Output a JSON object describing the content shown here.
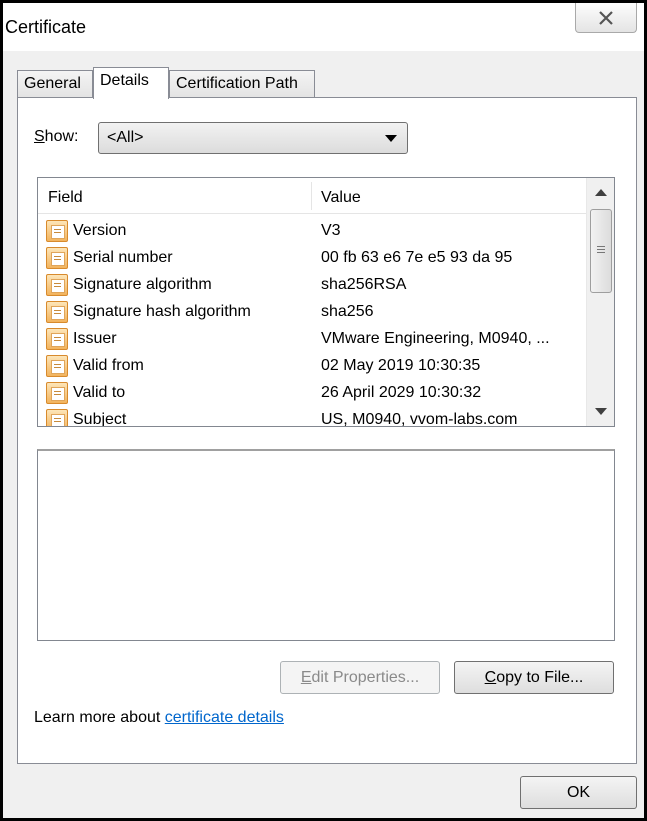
{
  "window": {
    "title": "Certificate"
  },
  "tabs": [
    {
      "label": "General"
    },
    {
      "label": "Details"
    },
    {
      "label": "Certification Path"
    }
  ],
  "show": {
    "label_key": "S",
    "label_rest": "how:",
    "selected": "<All>"
  },
  "fields": {
    "headers": {
      "field": "Field",
      "value": "Value"
    },
    "rows": [
      {
        "field": "Version",
        "value": "V3"
      },
      {
        "field": "Serial number",
        "value": "00 fb 63 e6 7e e5 93 da 95"
      },
      {
        "field": "Signature algorithm",
        "value": "sha256RSA"
      },
      {
        "field": "Signature hash algorithm",
        "value": "sha256"
      },
      {
        "field": "Issuer",
        "value": "VMware Engineering, M0940, ..."
      },
      {
        "field": "Valid from",
        "value": "02 May 2019 10:30:35"
      },
      {
        "field": "Valid to",
        "value": "26 April 2029 10:30:32"
      },
      {
        "field": "Subject",
        "value": "US, M0940, vvom-labs.com"
      }
    ]
  },
  "buttons": {
    "edit_key": "E",
    "edit_rest": "dit Properties...",
    "copy_key": "C",
    "copy_rest": "opy to File...",
    "ok": "OK"
  },
  "learn_more": {
    "prefix": "Learn more about ",
    "link": "certificate details"
  },
  "colors": {
    "link": "#0066cc",
    "dialog_bg": "#f0f0f0"
  }
}
